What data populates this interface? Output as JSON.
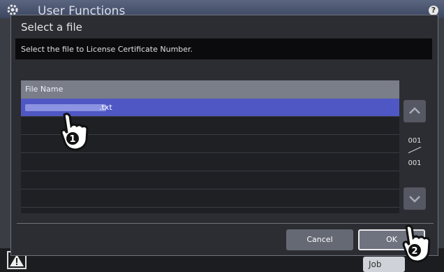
{
  "app": {
    "title": "User Functions",
    "help_label": "?"
  },
  "dialog": {
    "title": "Select a file",
    "message": "Select the file to License Certificate Number.",
    "list": {
      "header": "File Name",
      "rows": [
        {
          "name": ".txt",
          "selected": true
        },
        {
          "name": "",
          "selected": false
        },
        {
          "name": "",
          "selected": false
        },
        {
          "name": "",
          "selected": false
        },
        {
          "name": "",
          "selected": false
        },
        {
          "name": "",
          "selected": false
        }
      ]
    },
    "pager": {
      "current": "001",
      "total": "001"
    },
    "buttons": {
      "cancel": "Cancel",
      "ok": "OK"
    }
  },
  "bottom": {
    "job_label": "Job"
  },
  "callouts": {
    "step1": "1",
    "step2": "2"
  },
  "icons": {
    "scroll_up": "chevron-up-icon",
    "scroll_down": "chevron-down-icon",
    "warning": "warning-icon",
    "settings": "gear-icon",
    "pointer": "hand-pointer-icon"
  },
  "colors": {
    "selected_row": "#4f57c4",
    "header": "#7a7e88"
  }
}
